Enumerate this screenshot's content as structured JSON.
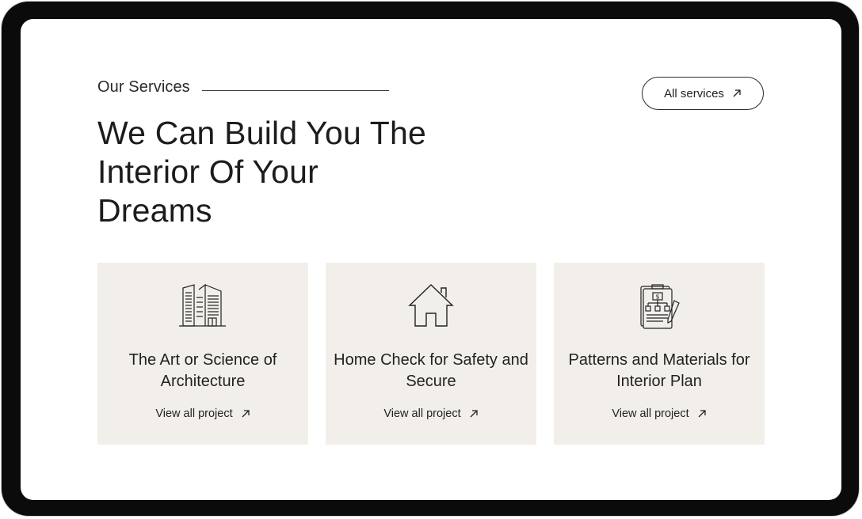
{
  "section": {
    "eyebrow": "Our Services",
    "heading": "We Can Build You The Interior Of Your Dreams",
    "all_services_label": "All services"
  },
  "cards": [
    {
      "icon": "buildings-icon",
      "title": "The Art or Science of Architecture",
      "link_label": "View all project"
    },
    {
      "icon": "house-icon",
      "title": "Home Check for Safety and Secure",
      "link_label": "View all project"
    },
    {
      "icon": "blueprint-plan-icon",
      "title": "Patterns and Materials for Interior Plan",
      "link_label": "View all project"
    }
  ],
  "colors": {
    "device_frame": "#0b0b0b",
    "card_background": "#f2efeb",
    "text": "#222222"
  }
}
